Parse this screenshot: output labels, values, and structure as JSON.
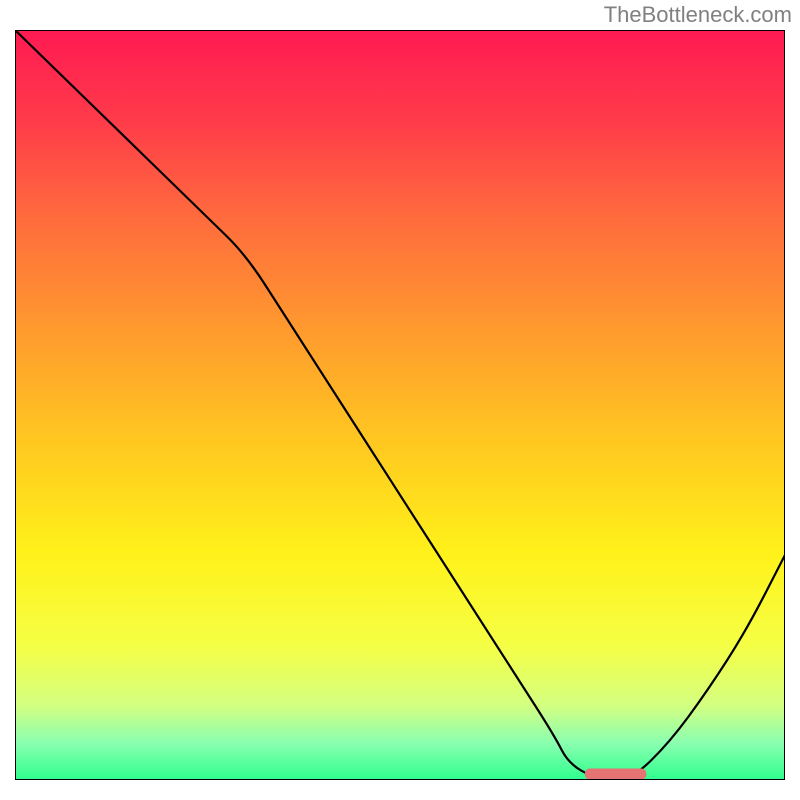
{
  "watermark": "TheBottleneck.com",
  "chart_data": {
    "type": "line",
    "title": "",
    "xlabel": "",
    "ylabel": "",
    "xlim": [
      0,
      100
    ],
    "ylim": [
      0,
      100
    ],
    "series": [
      {
        "name": "curve",
        "x": [
          0,
          5,
          15,
          20,
          25,
          30,
          35,
          40,
          45,
          50,
          55,
          60,
          65,
          70,
          72,
          76,
          80,
          85,
          90,
          95,
          100
        ],
        "y": [
          100,
          95,
          85,
          80,
          75,
          70,
          62,
          54,
          46,
          38,
          30,
          22,
          14,
          6,
          2,
          0,
          0,
          5,
          12,
          20,
          30
        ]
      }
    ],
    "marker": {
      "x_start": 74,
      "x_end": 82,
      "y": 0.8
    },
    "background_gradient": {
      "stops": [
        {
          "offset": 0.0,
          "color": "#ff1a52"
        },
        {
          "offset": 0.12,
          "color": "#ff3b4a"
        },
        {
          "offset": 0.25,
          "color": "#ff6b3d"
        },
        {
          "offset": 0.4,
          "color": "#ff9a2e"
        },
        {
          "offset": 0.55,
          "color": "#ffc820"
        },
        {
          "offset": 0.7,
          "color": "#fff21a"
        },
        {
          "offset": 0.82,
          "color": "#f5ff45"
        },
        {
          "offset": 0.9,
          "color": "#d4ff80"
        },
        {
          "offset": 0.95,
          "color": "#8bffb0"
        },
        {
          "offset": 1.0,
          "color": "#2eff8e"
        }
      ]
    }
  }
}
